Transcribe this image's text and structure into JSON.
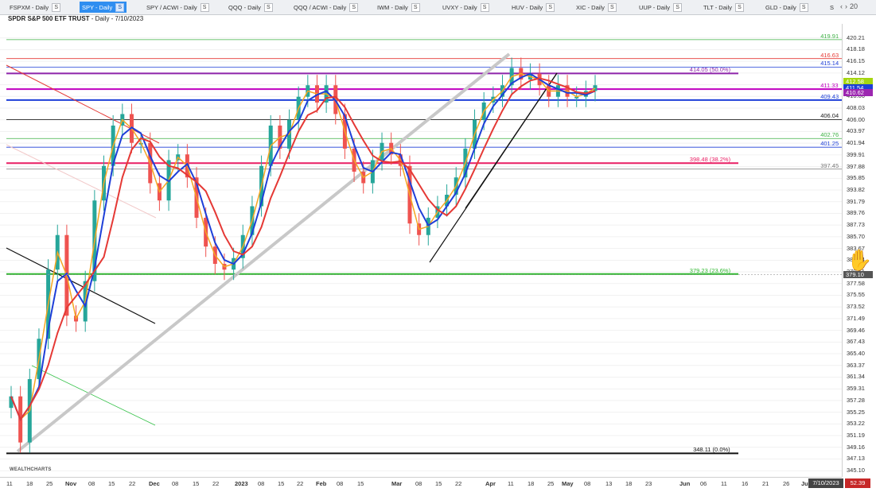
{
  "tabs": [
    {
      "label": "FSPXM - Daily",
      "badge": "S",
      "active": false
    },
    {
      "label": "SPY - Daily",
      "badge": "S",
      "active": true
    },
    {
      "label": "SPY / ACWI - Daily",
      "badge": "S",
      "active": false
    },
    {
      "label": "QQQ - Daily",
      "badge": "S",
      "active": false
    },
    {
      "label": "QQQ / ACWI - Daily",
      "badge": "S",
      "active": false
    },
    {
      "label": "IWM - Daily",
      "badge": "S",
      "active": false
    },
    {
      "label": "UVXY - Daily",
      "badge": "S",
      "active": false
    },
    {
      "label": "HUV - Daily",
      "badge": "S",
      "active": false
    },
    {
      "label": "XIC - Daily",
      "badge": "S",
      "active": false
    },
    {
      "label": "UUP - Daily",
      "badge": "S",
      "active": false
    },
    {
      "label": "TLT - Daily",
      "badge": "S",
      "active": false
    },
    {
      "label": "GLD - Daily",
      "badge": "S",
      "active": false
    },
    {
      "label": "S",
      "badge": "",
      "active": false
    }
  ],
  "tab_nav": {
    "more_label": "20"
  },
  "chart_title": {
    "name": "SPDR S&P 500 ETF TRUST",
    "meta": " - Daily - 7/10/2023"
  },
  "chart_data": {
    "type": "candlestick",
    "yticks": [
      "420.21",
      "418.18",
      "416.15",
      "414.12",
      "412.09",
      "410.06",
      "408.03",
      "406.00",
      "403.97",
      "401.94",
      "399.91",
      "397.88",
      "395.85",
      "393.82",
      "391.79",
      "389.76",
      "387.73",
      "385.70",
      "383.67",
      "381.64",
      "379.61",
      "377.58",
      "375.55",
      "373.52",
      "371.49",
      "369.46",
      "367.43",
      "365.40",
      "363.37",
      "361.34",
      "359.31",
      "357.28",
      "355.25",
      "353.22",
      "351.19",
      "349.16",
      "347.13",
      "345.10"
    ],
    "ylim": [
      344.3,
      421.0
    ],
    "xticks": [
      {
        "label": "11",
        "bold": false
      },
      {
        "label": "18",
        "bold": false
      },
      {
        "label": "25",
        "bold": false
      },
      {
        "label": "Nov",
        "bold": true
      },
      {
        "label": "08",
        "bold": false
      },
      {
        "label": "15",
        "bold": false
      },
      {
        "label": "22",
        "bold": false
      },
      {
        "label": "Dec",
        "bold": true
      },
      {
        "label": "08",
        "bold": false
      },
      {
        "label": "15",
        "bold": false
      },
      {
        "label": "22",
        "bold": false
      },
      {
        "label": "2023",
        "bold": true
      },
      {
        "label": "08",
        "bold": false
      },
      {
        "label": "15",
        "bold": false
      },
      {
        "label": "22",
        "bold": false
      },
      {
        "label": "Feb",
        "bold": true
      },
      {
        "label": "08",
        "bold": false
      },
      {
        "label": "15",
        "bold": false
      },
      {
        "label": "Mar",
        "bold": true
      },
      {
        "label": "08",
        "bold": false
      },
      {
        "label": "15",
        "bold": false
      },
      {
        "label": "22",
        "bold": false
      },
      {
        "label": "Apr",
        "bold": true
      },
      {
        "label": "11",
        "bold": false
      },
      {
        "label": "18",
        "bold": false
      },
      {
        "label": "25",
        "bold": false
      },
      {
        "label": "May",
        "bold": true
      },
      {
        "label": "08",
        "bold": false
      },
      {
        "label": "13",
        "bold": false
      },
      {
        "label": "18",
        "bold": false
      },
      {
        "label": "23",
        "bold": false
      },
      {
        "label": "Jun",
        "bold": true
      },
      {
        "label": "06",
        "bold": false
      },
      {
        "label": "11",
        "bold": false
      },
      {
        "label": "16",
        "bold": false
      },
      {
        "label": "21",
        "bold": false
      },
      {
        "label": "26",
        "bold": false
      },
      {
        "label": "Ju",
        "bold": true
      }
    ],
    "levels": [
      {
        "value": 419.91,
        "label": "419.91",
        "color": "#3cb043",
        "thick": false
      },
      {
        "value": 416.63,
        "label": "416.63",
        "color": "#e53935",
        "thick": false
      },
      {
        "value": 415.14,
        "label": "415.14",
        "color": "#1e3fd8",
        "thick": false
      },
      {
        "value": 414.05,
        "label": "414.05 (50.0%)",
        "color": "#8e24aa",
        "thick": true,
        "fib": true
      },
      {
        "value": 411.33,
        "label": "411.33",
        "color": "#c000c0",
        "thick": true
      },
      {
        "value": 409.43,
        "label": "409.43",
        "color": "#1e3fd8",
        "thick": true
      },
      {
        "value": 406.04,
        "label": "406.04",
        "color": "#222222",
        "thick": false
      },
      {
        "value": 402.76,
        "label": "402.76",
        "color": "#3cb043",
        "thick": false
      },
      {
        "value": 401.25,
        "label": "401.25",
        "color": "#1e3fd8",
        "thick": false
      },
      {
        "value": 398.48,
        "label": "398.48 (38.2%)",
        "color": "#e91e63",
        "thick": true,
        "fib": true
      },
      {
        "value": 397.45,
        "label": "397.45",
        "color": "#777777",
        "thick": false
      },
      {
        "value": 379.23,
        "label": "379.23 (23.6%)",
        "color": "#2eb82e",
        "thick": true,
        "fib": true
      },
      {
        "value": 348.11,
        "label": "348.11 (0.0%)",
        "color": "#111111",
        "thick": true,
        "fib": true
      }
    ],
    "price_tags": [
      {
        "value": 412.58,
        "label": "412.58",
        "bg": "#a5d610"
      },
      {
        "value": 411.54,
        "label": "411.54",
        "bg": "#1e3fd8"
      },
      {
        "value": 410.62,
        "label": "410.62",
        "bg": "#9c27b0"
      },
      {
        "value": 379.1,
        "label": "379.10",
        "bg": "#555555"
      }
    ],
    "last_date": "7/10/2023",
    "last_value": "52.39",
    "closes": [
      358,
      350,
      361,
      368,
      380,
      386,
      372,
      371,
      378,
      392,
      398,
      405,
      407,
      402,
      402,
      395,
      392,
      399,
      400,
      396,
      389,
      384,
      381,
      380,
      382,
      386,
      391,
      398,
      405,
      401,
      406,
      410,
      412,
      409,
      412,
      407,
      401,
      397,
      395,
      399,
      402,
      400,
      398,
      388,
      386,
      389,
      391,
      393,
      396,
      401,
      406,
      409,
      410,
      412,
      415,
      413,
      414,
      412,
      410,
      412,
      410,
      410,
      411,
      412
    ]
  },
  "logo_text": "WEALTHCHARTS"
}
